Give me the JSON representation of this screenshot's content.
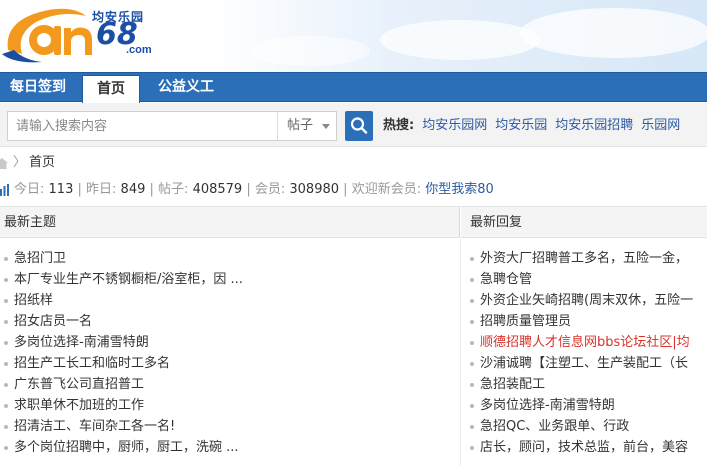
{
  "header": {
    "logo_text": "an68",
    "logo_subtitle": "均安乐园",
    "logo_domain": ".com"
  },
  "nav": {
    "items": [
      {
        "label": "每日签到",
        "active": false
      },
      {
        "label": "首页",
        "active": true
      },
      {
        "label": "公益义工",
        "active": false
      }
    ]
  },
  "search": {
    "placeholder": "请输入搜索内容",
    "type_selected": "帖子",
    "hot_label": "热搜:",
    "hot_links": [
      "均安乐园网",
      "均安乐园",
      "均安乐园招聘",
      "乐园网"
    ]
  },
  "breadcrumb": {
    "current": "首页"
  },
  "stats": {
    "today_label": "今日:",
    "today": "113",
    "yesterday_label": "昨日:",
    "yesterday": "849",
    "posts_label": "帖子:",
    "posts": "408579",
    "members_label": "会员:",
    "members": "308980",
    "welcome_label": "欢迎新会员:",
    "newest_member": "你型我索80"
  },
  "panels": {
    "left_title": "最新主题",
    "right_title": "最新回复",
    "latest_topics": [
      "急招门卫",
      "本厂专业生产不锈钢橱柜/浴室柜，因 ...",
      "招纸样",
      "招女店员一名",
      "多岗位选择-南浦雪特朗",
      "招生产工长工和临时工多名",
      "广东普飞公司直招普工",
      "求职单休不加班的工作",
      "招清洁工、车间杂工各一名!",
      "多个岗位招聘中，厨师，厨工，洗碗 ..."
    ],
    "latest_replies": [
      {
        "text": "外资大厂招聘普工多名，五险一金，",
        "highlight": false
      },
      {
        "text": "急聘仓管",
        "highlight": false
      },
      {
        "text": "外资企业矢崎招聘(周末双休，五险一",
        "highlight": false
      },
      {
        "text": "招聘质量管理员",
        "highlight": false
      },
      {
        "text": "顺德招聘人才信息网bbs论坛社区|均",
        "highlight": true
      },
      {
        "text": "沙浦诚聘【注塑工、生产装配工（长",
        "highlight": false
      },
      {
        "text": "急招装配工",
        "highlight": false
      },
      {
        "text": "多岗位选择-南浦雪特朗",
        "highlight": false
      },
      {
        "text": "急招QC、业务跟单、行政",
        "highlight": false
      },
      {
        "text": "店长，顾问，技术总监，前台，美容",
        "highlight": false
      }
    ]
  },
  "colors": {
    "nav_blue": "#2b6fb9",
    "link_blue": "#2b5aa3",
    "highlight_red": "#d8322b",
    "logo_orange": "#f39a1e"
  }
}
